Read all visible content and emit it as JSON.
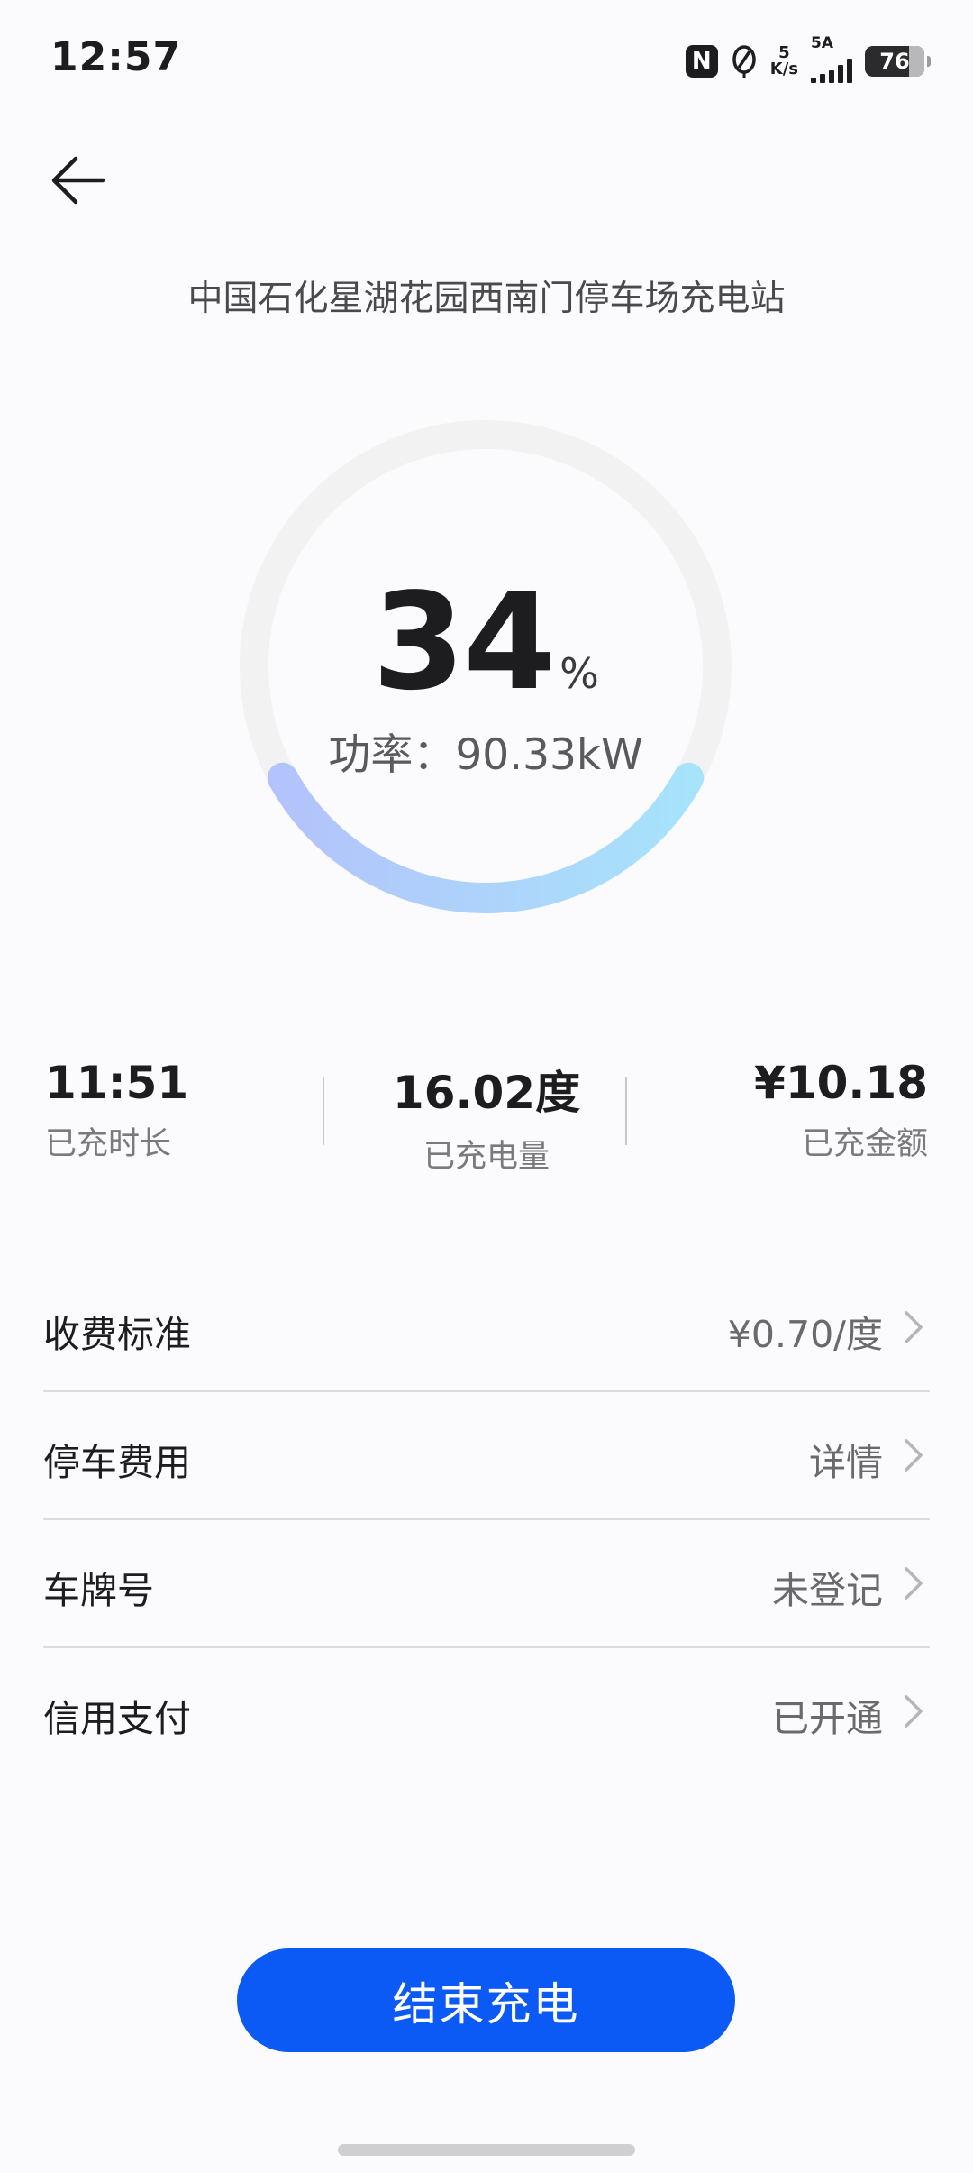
{
  "status_bar": {
    "time": "12:57",
    "nfc_label": "N",
    "net_speed_value": "5",
    "net_speed_unit": "K/s",
    "signal_label": "5A",
    "battery": "76",
    "icons": [
      "nfc-icon",
      "leaf-icon",
      "signal-icon",
      "battery-icon"
    ]
  },
  "nav": {
    "back_icon": "arrow-left-icon"
  },
  "station_name": "中国石化星湖花园西南门停车场充电站",
  "progress": {
    "percent_value": "34",
    "percent_unit": "%",
    "fraction": 0.34,
    "power": "功率：90.33kW",
    "colors": {
      "track": "#f2f2f3",
      "start": "#b3c3fb",
      "end": "#a7e3fb"
    }
  },
  "stats": [
    {
      "value": "11:51",
      "label": "已充时长"
    },
    {
      "value": "16.02度",
      "label": "已充电量"
    },
    {
      "value": "¥10.18",
      "label": "已充金额"
    }
  ],
  "rows": [
    {
      "label": "收费标准",
      "value": "¥0.70/度"
    },
    {
      "label": "停车费用",
      "value": "详情"
    },
    {
      "label": "车牌号",
      "value": "未登记"
    },
    {
      "label": "信用支付",
      "value": "已开通"
    }
  ],
  "end_button": {
    "label": "结束充电",
    "color": "#0b5af5"
  }
}
